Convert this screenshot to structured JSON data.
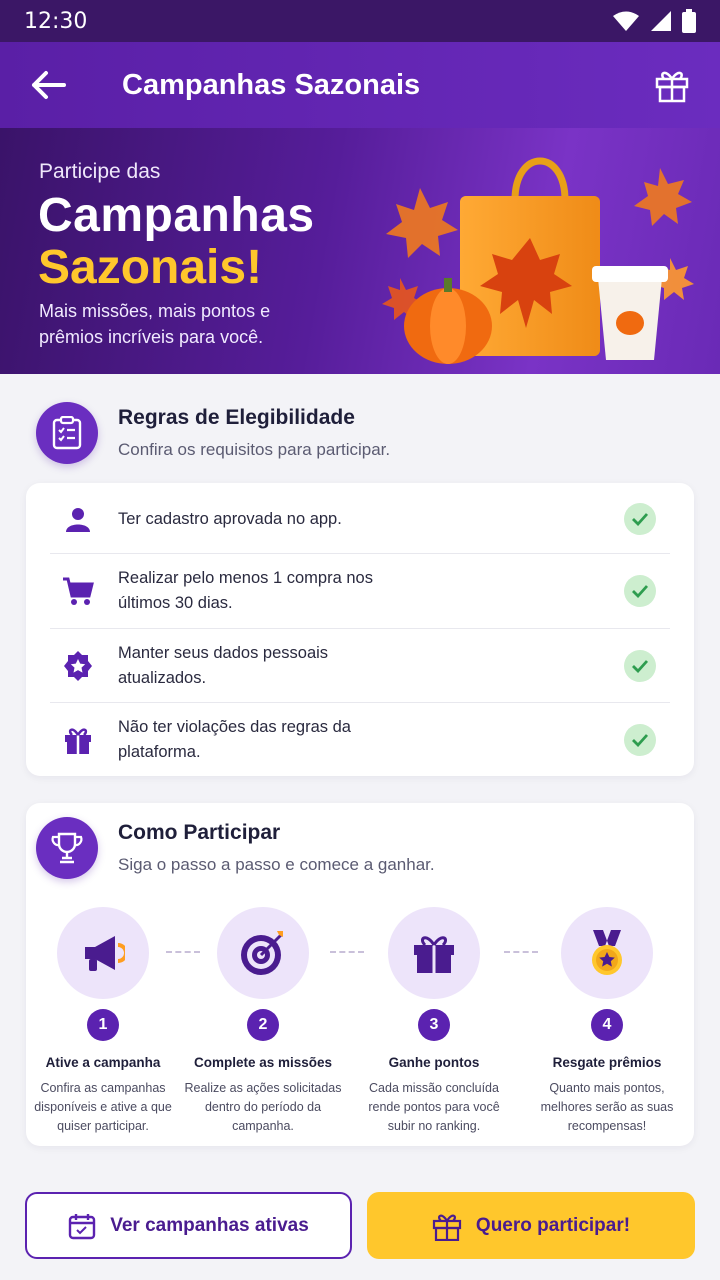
{
  "status": {
    "time": "12:30"
  },
  "appbar": {
    "title": "Campanhas Sazonais"
  },
  "hero": {
    "pre": "Participe das",
    "line1": "Campanhas",
    "line2": "Sazonais!",
    "sub": "Mais missões, mais pontos e prêmios incríveis para você."
  },
  "eligibility": {
    "title": "Regras de Elegibilidade",
    "subtitle": "Confira os requisitos para participar.",
    "rules": [
      {
        "icon": "person-icon",
        "text": "Ter cadastro aprovada no app."
      },
      {
        "icon": "cart-icon",
        "text": "Realizar pelo menos 1 compra nos últimos 30 dias."
      },
      {
        "icon": "badge-star-icon",
        "text": "Manter seus dados pessoais atualizados."
      },
      {
        "icon": "gift-icon",
        "text": "Não ter violações das regras da plataforma."
      }
    ]
  },
  "howto": {
    "title": "Como Participar",
    "subtitle": "Siga o passo a passo e comece a ganhar.",
    "steps": [
      {
        "num": "1",
        "icon": "megaphone-icon",
        "title": "Ative a campanha",
        "desc": "Confira as campanhas disponíveis e ative a que quiser participar."
      },
      {
        "num": "2",
        "icon": "target-icon",
        "title": "Complete as missões",
        "desc": "Realize as ações solicitadas dentro do período da campanha."
      },
      {
        "num": "3",
        "icon": "gift-icon",
        "title": "Ganhe pontos",
        "desc": "Cada missão concluída rende pontos para você subir no ranking."
      },
      {
        "num": "4",
        "icon": "medal-icon",
        "title": "Resgate prêmios",
        "desc": "Quanto mais pontos, melhores serão as suas recompensas!"
      }
    ]
  },
  "actions": {
    "secondary": "Ver campanhas ativas",
    "primary": "Quero participar!"
  },
  "colors": {
    "brand": "#5b22b0",
    "accent": "#ffc72c",
    "check": "#2e9d4f"
  }
}
